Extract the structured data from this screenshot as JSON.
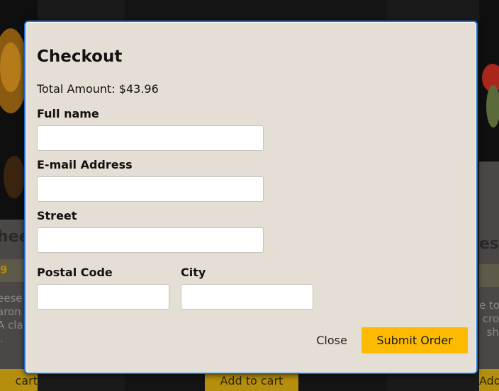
{
  "background": {
    "cards": [
      {
        "title": "hee",
        "price": "9",
        "desc": [
          "eese",
          "aron",
          "A cla",
          "l."
        ],
        "button": "cart"
      },
      {
        "title": "",
        "price": "",
        "desc": [],
        "button": "Add to cart"
      },
      {
        "title": "es",
        "price": "",
        "desc": [
          "e to",
          "cro",
          "sh"
        ],
        "button": "Add"
      }
    ]
  },
  "modal": {
    "title": "Checkout",
    "total": "Total Amount: $43.96",
    "fields": {
      "full_name": {
        "label": "Full name",
        "value": ""
      },
      "email": {
        "label": "E-mail Address",
        "value": ""
      },
      "street": {
        "label": "Street",
        "value": ""
      },
      "postal_code": {
        "label": "Postal Code",
        "value": ""
      },
      "city": {
        "label": "City",
        "value": ""
      }
    },
    "close_label": "Close",
    "submit_label": "Submit Order"
  },
  "colors": {
    "accent": "#fdbb00",
    "modal_bg": "#e5ded5",
    "focus_border": "#1f6fd1"
  }
}
